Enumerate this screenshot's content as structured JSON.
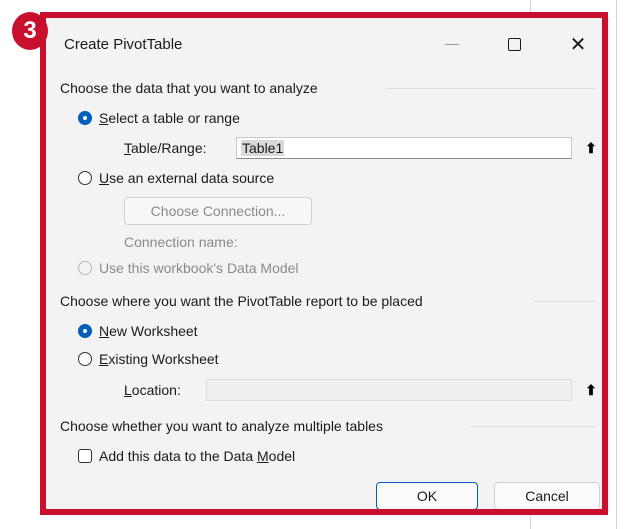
{
  "step_badge": "3",
  "dialog": {
    "title": "Create PivotTable",
    "section_data": "Choose the data that you want to analyze",
    "radio_table": {
      "pre": "",
      "key": "S",
      "post": "elect a table or range",
      "checked": true
    },
    "table_range": {
      "pre": "",
      "key": "T",
      "post": "able/Range:",
      "value": "Table1"
    },
    "radio_external": {
      "pre": "",
      "key": "U",
      "post": "se an external data source",
      "checked": false
    },
    "choose_connection": "Choose Connection...",
    "connection_name": "Connection name:",
    "radio_data_model": "Use this workbook's Data Model",
    "section_place": "Choose where you want the PivotTable report to be placed",
    "radio_new_ws": {
      "pre": "",
      "key": "N",
      "post": "ew Worksheet",
      "checked": true
    },
    "radio_existing_ws": {
      "pre": "",
      "key": "E",
      "post": "xisting Worksheet",
      "checked": false
    },
    "location": {
      "pre": "",
      "key": "L",
      "post": "ocation:",
      "value": ""
    },
    "section_multi": "Choose whether you want to analyze multiple tables",
    "check_data_model": {
      "pre": "Add this data to the Data ",
      "key": "M",
      "post": "odel",
      "checked": false
    },
    "ok_label": "OK",
    "cancel_label": "Cancel"
  },
  "icons": {
    "minimize": "minimize-icon",
    "maximize": "maximize-icon",
    "close": "close-icon",
    "collapse": "collapse-dialog-icon"
  },
  "colors": {
    "accent": "#005fb8",
    "highlight": "#c8102e"
  }
}
